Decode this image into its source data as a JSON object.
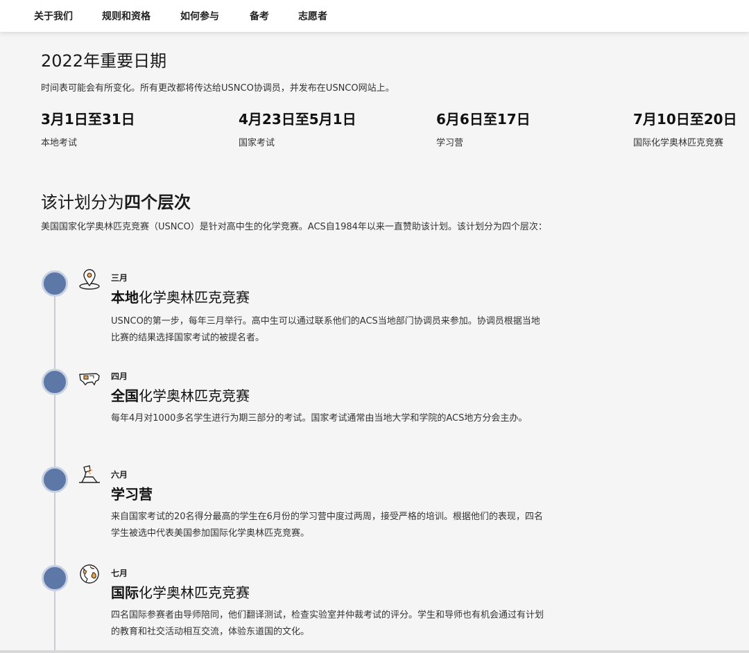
{
  "nav": {
    "items": [
      "关于我们",
      "规则和资格",
      "如何参与",
      "备考",
      "志愿者"
    ]
  },
  "dates": {
    "title": "2022年重要日期",
    "note": "时间表可能会有所变化。所有更改都将传达给USNCO协调员，并发布在USNCO网站上。",
    "items": [
      {
        "range": "3月1日至31日",
        "label": "本地考试"
      },
      {
        "range": "4月23日至5月1日",
        "label": "国家考试"
      },
      {
        "range": "6月6日至17日",
        "label": "学习营"
      },
      {
        "range": "7月10日至20日",
        "label": "国际化学奥林匹克竞赛"
      }
    ]
  },
  "levels": {
    "title_prefix": "该计划分为",
    "title_strong": "四个层次",
    "intro": "美国国家化学奥林匹克竞赛（USNCO）是针对高中生的化学竞赛。ACS自1984年以来一直赞助该计划。该计划分为四个层次：",
    "items": [
      {
        "month": "三月",
        "title_strong": "本地",
        "title_rest": "化学奥林匹克竞赛",
        "desc": "USNCO的第一步，每年三月举行。高中生可以通过联系他们的ACS当地部门协调员来参加。协调员根据当地比赛的结果选择国家考试的被提名者。",
        "icon": "location-pin-icon"
      },
      {
        "month": "四月",
        "title_strong": "全国",
        "title_rest": "化学奥林匹克竞赛",
        "desc": "每年4月对1000多名学生进行为期三部分的考试。国家考试通常由当地大学和学院的ACS地方分会主办。",
        "icon": "us-map-icon"
      },
      {
        "month": "六月",
        "title_strong": "学习营",
        "title_rest": "",
        "desc": "来自国家考试的20名得分最高的学生在6月份的学习营中度过两周，接受严格的培训。根据他们的表现，四名学生被选中代表美国参加国际化学奥林匹克竞赛。",
        "icon": "study-lamp-icon"
      },
      {
        "month": "七月",
        "title_strong": "国际",
        "title_rest": "化学奥林匹克竞赛",
        "desc": "四名国际参赛者由导师陪同，他们翻译测试，检查实验室并仲裁考试的评分。学生和导师也有机会通过有计划的教育和社交活动相互交流，体验东道国的文化。",
        "icon": "globe-icon"
      }
    ]
  },
  "colors": {
    "dot": "#5d77a6",
    "dot_ring": "#c6d0e2",
    "line": "#c9ccd3",
    "icon_accent": "#e8a24a"
  }
}
